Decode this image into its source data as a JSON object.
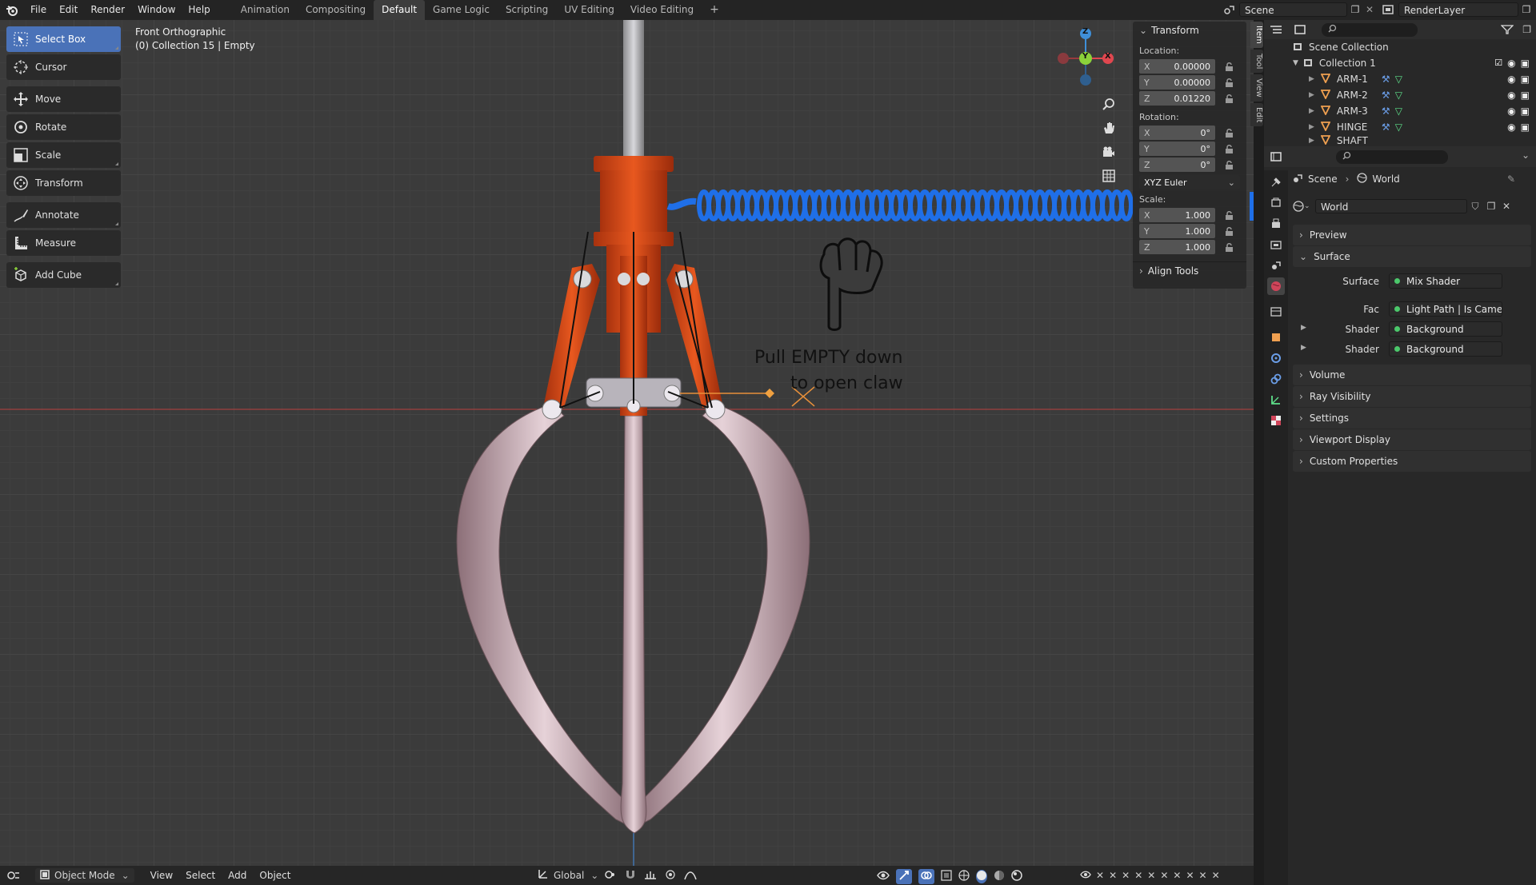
{
  "topbar": {
    "menus": [
      "File",
      "Edit",
      "Render",
      "Window",
      "Help"
    ],
    "workspaces": [
      "Animation",
      "Compositing",
      "Default",
      "Game Logic",
      "Scripting",
      "UV Editing",
      "Video Editing"
    ],
    "active_workspace": "Default",
    "add_label": "+",
    "scene": "Scene",
    "render_layer": "RenderLayer"
  },
  "viewport": {
    "view_name": "Front Orthographic",
    "view_info": "(0) Collection 15 | Empty",
    "annotation_line1": "Pull EMPTY down",
    "annotation_line2": "to open  claw",
    "gizmo": {
      "z": "Z",
      "y": "Y",
      "x": "X"
    }
  },
  "toolbar": {
    "tools": [
      {
        "label": "Select Box",
        "icon": "select-box-icon",
        "active": true
      },
      {
        "label": "Cursor",
        "icon": "cursor-icon"
      },
      {
        "label": "Move",
        "icon": "move-icon"
      },
      {
        "label": "Rotate",
        "icon": "rotate-icon"
      },
      {
        "label": "Scale",
        "icon": "scale-icon"
      },
      {
        "label": "Transform",
        "icon": "transform-icon"
      },
      {
        "label": "Annotate",
        "icon": "annotate-icon"
      },
      {
        "label": "Measure",
        "icon": "measure-icon"
      },
      {
        "label": "Add Cube",
        "icon": "add-cube-icon"
      }
    ]
  },
  "npanel": {
    "title": "Transform",
    "location_label": "Location:",
    "location": {
      "x": "0.00000",
      "y": "0.00000",
      "z": "0.01220"
    },
    "rotation_label": "Rotation:",
    "rotation": {
      "x": "0°",
      "y": "0°",
      "z": "0°"
    },
    "rotation_mode": "XYZ Euler",
    "scale_label": "Scale:",
    "scale": {
      "x": "1.000",
      "y": "1.000",
      "z": "1.000"
    },
    "align_tools": "Align Tools",
    "axis": {
      "x": "X",
      "y": "Y",
      "z": "Z"
    },
    "tabs": [
      "Item",
      "Tool",
      "View",
      "Edit"
    ]
  },
  "statusbar": {
    "mode": "Object Mode",
    "menus": [
      "View",
      "Select",
      "Add",
      "Object"
    ],
    "orientation": "Global"
  },
  "outliner": {
    "root": "Scene Collection",
    "collection": "Collection 1",
    "objects": [
      "ARM-1",
      "ARM-2",
      "ARM-3",
      "HINGE",
      "SHAFT"
    ]
  },
  "properties": {
    "breadcrumb_scene": "Scene",
    "breadcrumb_world": "World",
    "world_name": "World",
    "sections": {
      "preview": "Preview",
      "surface": "Surface",
      "volume": "Volume",
      "ray_visibility": "Ray Visibility",
      "settings": "Settings",
      "viewport_display": "Viewport Display",
      "custom_properties": "Custom Properties"
    },
    "surface_rows": [
      {
        "key": "Surface",
        "value": "Mix Shader"
      },
      {
        "key": "Fac",
        "value": "Light Path | Is Camera ..."
      },
      {
        "key": "Shader",
        "value": "Background"
      },
      {
        "key": "Shader",
        "value": "Background"
      }
    ]
  },
  "colors": {
    "accent": "#4a72b8",
    "claw_orange": "#d9481a",
    "spring_blue": "#1f6fe8",
    "claw_pink": "#cdb0b8",
    "x_axis": "#e0474f",
    "y_axis": "#8bd23a",
    "z_axis": "#3f8fd8"
  }
}
